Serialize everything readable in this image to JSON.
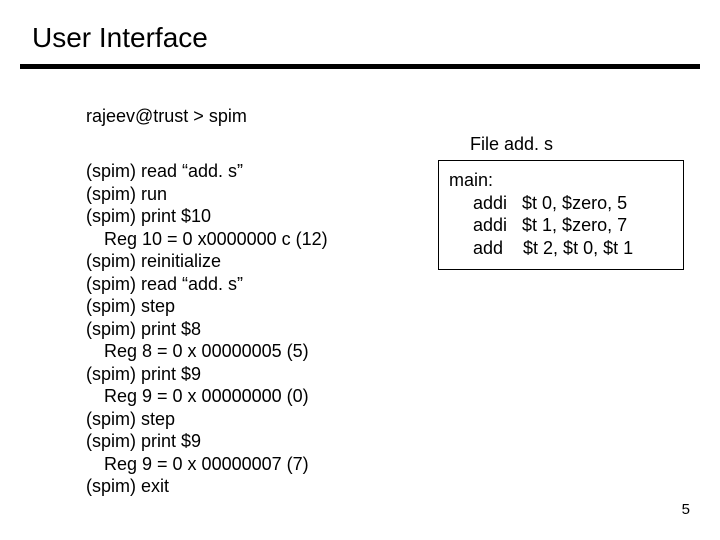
{
  "title": "User Interface",
  "shell_prompt": "rajeev@trust > spim",
  "transcript": [
    {
      "text": "(spim)  read “add. s”",
      "indent": false
    },
    {
      "text": "(spim)  run",
      "indent": false
    },
    {
      "text": "(spim)  print  $10",
      "indent": false
    },
    {
      "text": "Reg 10 = 0 x0000000 c (12)",
      "indent": true
    },
    {
      "text": "(spim)  reinitialize",
      "indent": false
    },
    {
      "text": "(spim)  read “add. s”",
      "indent": false
    },
    {
      "text": "(spim)  step",
      "indent": false
    },
    {
      "text": "(spim)  print $8",
      "indent": false
    },
    {
      "text": "Reg 8 = 0 x 00000005  (5)",
      "indent": true
    },
    {
      "text": "(spim)  print $9",
      "indent": false
    },
    {
      "text": "Reg 9 = 0 x 00000000  (0)",
      "indent": true
    },
    {
      "text": "(spim)  step",
      "indent": false
    },
    {
      "text": "(spim)  print $9",
      "indent": false
    },
    {
      "text": "Reg 9 = 0 x 00000007  (7)",
      "indent": true
    },
    {
      "text": "(spim)  exit",
      "indent": false
    }
  ],
  "file": {
    "caption": "File add. s",
    "label": "main:",
    "lines": [
      "addi   $t 0, $zero, 5",
      "addi   $t 1, $zero, 7",
      "add    $t 2, $t 0, $t 1"
    ]
  },
  "page_number": "5"
}
